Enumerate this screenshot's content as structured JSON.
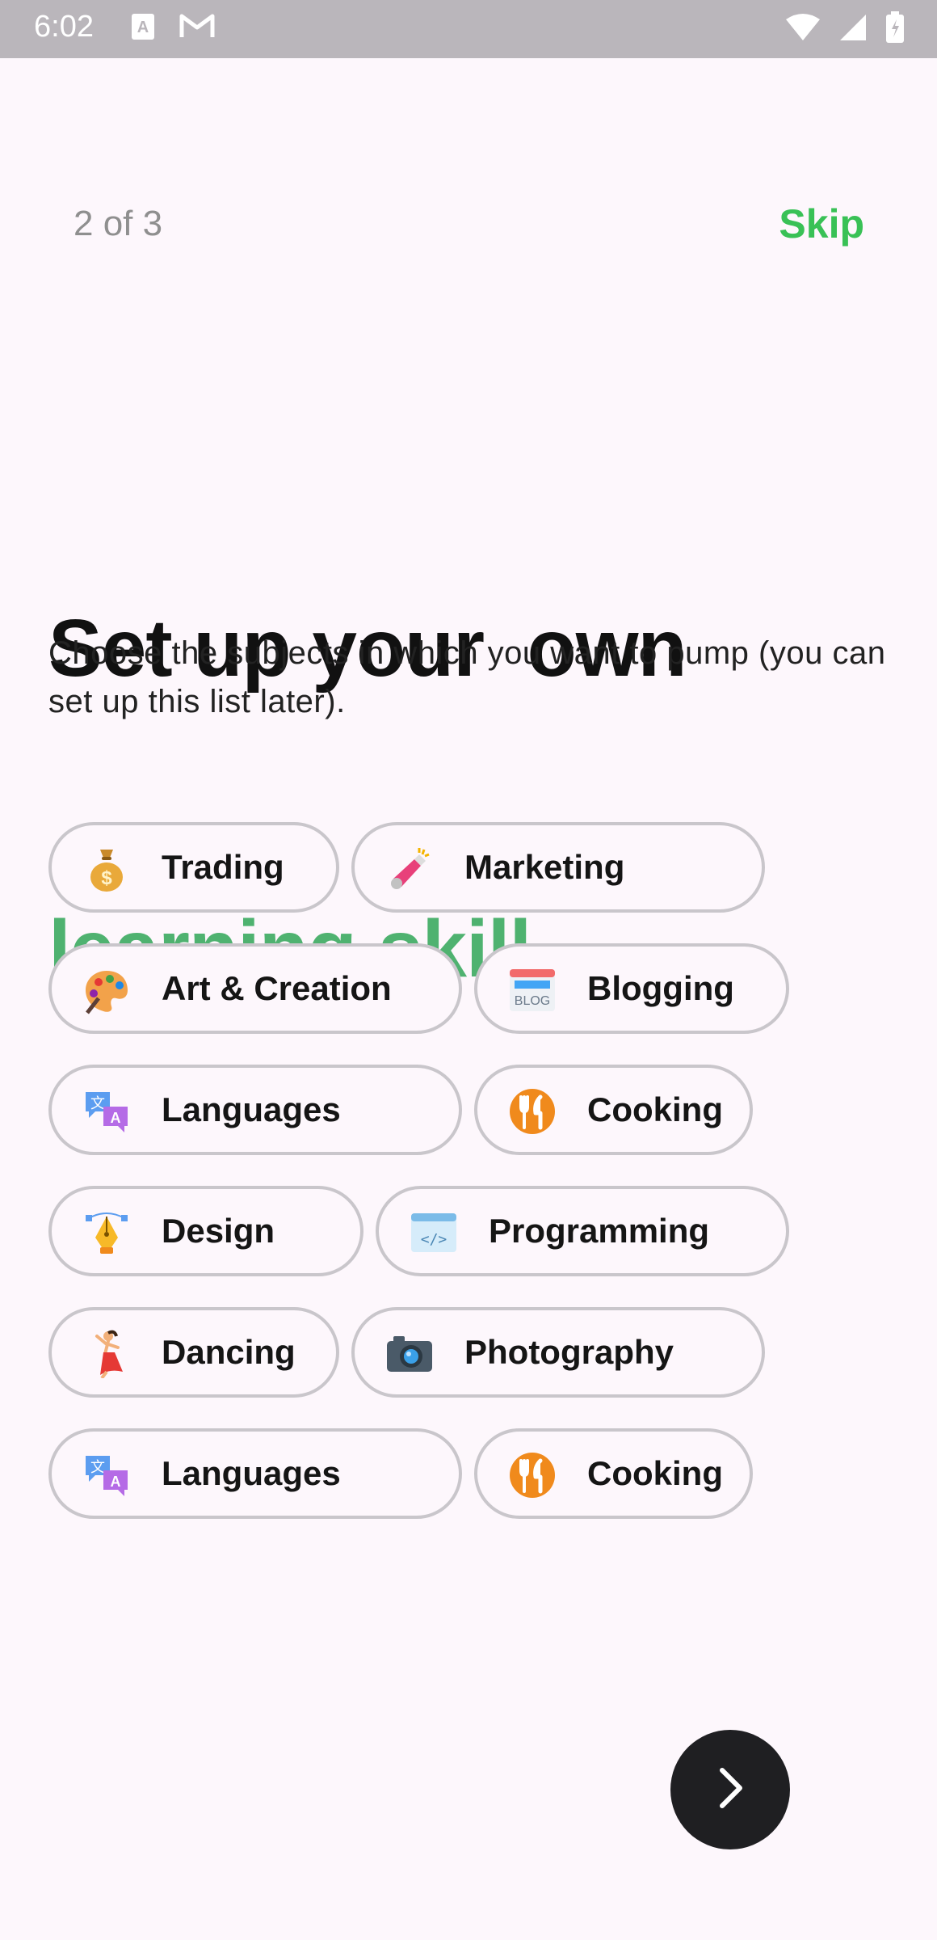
{
  "status_bar": {
    "time": "6:02"
  },
  "header": {
    "progress": "2 of 3",
    "skip_label": "Skip"
  },
  "title": {
    "line1": "Set up your  own",
    "line2": "learning skill."
  },
  "subtitle": "Choose the subjects in which you want to pump (you can set up this list later).",
  "chips": [
    {
      "label": "Trading",
      "icon": "money-bag-icon"
    },
    {
      "label": "Marketing",
      "icon": "megaphone-icon"
    },
    {
      "label": "Art & Creation",
      "icon": "palette-icon"
    },
    {
      "label": "Blogging",
      "icon": "blog-icon"
    },
    {
      "label": "Languages",
      "icon": "translate-icon"
    },
    {
      "label": "Cooking",
      "icon": "fork-knife-icon"
    },
    {
      "label": "Design",
      "icon": "pen-tool-icon"
    },
    {
      "label": "Programming",
      "icon": "code-window-icon"
    },
    {
      "label": "Dancing",
      "icon": "dancer-icon"
    },
    {
      "label": "Photography",
      "icon": "camera-icon"
    },
    {
      "label": "Languages",
      "icon": "translate-icon"
    },
    {
      "label": "Cooking",
      "icon": "fork-knife-icon"
    }
  ],
  "colors": {
    "accent": "#39c156",
    "title_accent": "#4fb270",
    "next_button": "#1f1f22"
  }
}
